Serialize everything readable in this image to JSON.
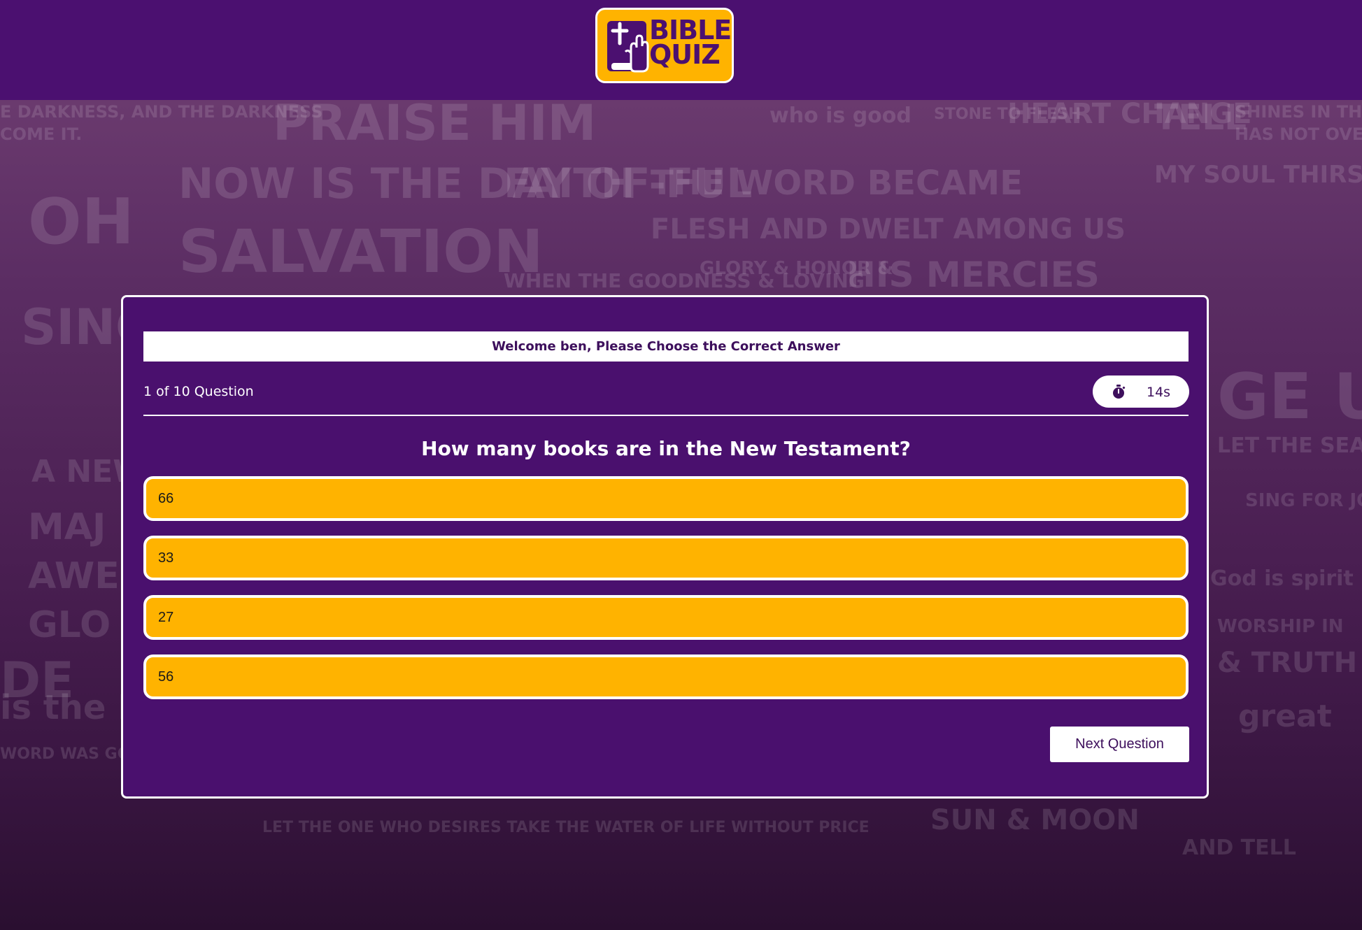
{
  "header": {
    "logo_text": "BIBLE\nQUIZ"
  },
  "background_words": [
    "E DARKNESS, AND THE DARKNESS",
    "COME IT.",
    "PRAISE HIM",
    "who is good",
    "STONE TO FLESH",
    "HEART CHANGE",
    "TELL",
    "SHINES IN THE D",
    "HAS NOT OVERCO",
    "OH",
    "NOW IS THE DAY OF",
    "SALVATION",
    "FAITH -FUL",
    "THE WORD BECAME",
    "FLESH AND DWELT AMONG US",
    "MY SOUL THIRSTS FOR GOD, FOR THE Living",
    "WHEN THE GOODNESS & LOVING",
    "GLORY & HONOR &",
    "HIS MERCIES",
    "SING",
    "A NEW SO",
    "MAJ",
    "AWE",
    "GLO",
    "DE",
    "GE UP!",
    "LET THE SEA ROAR!",
    "SING FOR JOY",
    "God is spirit & him",
    "WORSHIP IN",
    "& TRUTH",
    "is the L",
    "WORD WAS GOD",
    "great",
    "LET THE ONE WHO DESIRES TAKE THE WATER OF LIFE WITHOUT PRICE",
    "SUN & MOON",
    "AND TELL"
  ],
  "quiz": {
    "welcome": "Welcome ben, Please Choose the Correct Answer",
    "counter": "1 of 10 Question",
    "timer": "14s",
    "question": "How many books are in the New Testament?",
    "options": [
      "66",
      "33",
      "27",
      "56"
    ],
    "next_label": "Next Question"
  },
  "colors": {
    "brand_purple": "#4b1070",
    "card_purple": "#4a106e",
    "option_yellow": "#ffb300",
    "text_dark": "#3d0f5c"
  }
}
